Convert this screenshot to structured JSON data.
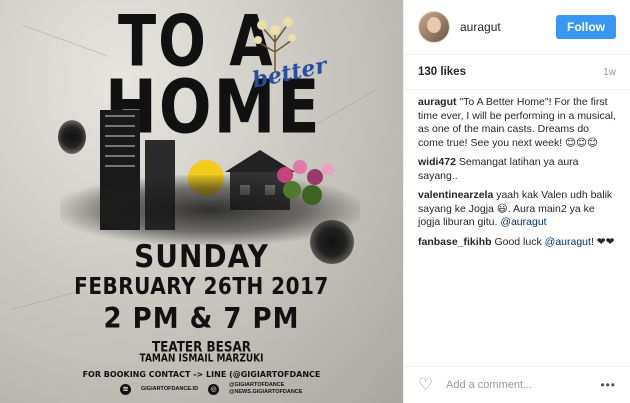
{
  "poster": {
    "title_line1": "TO A",
    "title_better": "better",
    "title_line2": "HOME",
    "day": "SUNDAY",
    "date": "FEBRUARY 26TH 2017",
    "time": "2 PM & 7 PM",
    "venue": "TEATER BESAR",
    "venue_sub": "TAMAN ISMAIL MARZUKI",
    "booking": "FOR BOOKING CONTACT -> LINE (@GIGIARTOFDANCE",
    "spotify": "GIGIARTOFDANCE.ID",
    "instagram_1": "@GIGIARTOFDANCE",
    "instagram_2": "@NEWS.GIGIARTOFDANCE"
  },
  "header": {
    "username": "auragut",
    "follow_label": "Follow"
  },
  "meta": {
    "likes": "130 likes",
    "time_ago": "1w"
  },
  "comments": [
    {
      "user": "auragut",
      "text": " \"To A Better Home\"! For the first time ever, I will be performing in a musical, as one of the main casts. Dreams do come true! See you next week! 😊😊😊",
      "mention": ""
    },
    {
      "user": "widi472",
      "text": " Semangat latihan ya aura sayang..",
      "mention": ""
    },
    {
      "user": "valentinearzela",
      "text": " yaah kak Valen udh balik sayang ke Jogja 😃. Aura main2 ya ke jogja liburan gitu. ",
      "mention": "@auragut"
    },
    {
      "user": "fanbase_fikihb",
      "text": " Good luck ",
      "mention": "@auragut",
      "tail": "! ❤❤"
    }
  ],
  "add_comment": {
    "placeholder": "Add a comment..."
  },
  "icons": {
    "like": "heart-icon",
    "more": "more-options-icon"
  },
  "colors": {
    "follow": "#3897f0",
    "mention": "#003569"
  }
}
